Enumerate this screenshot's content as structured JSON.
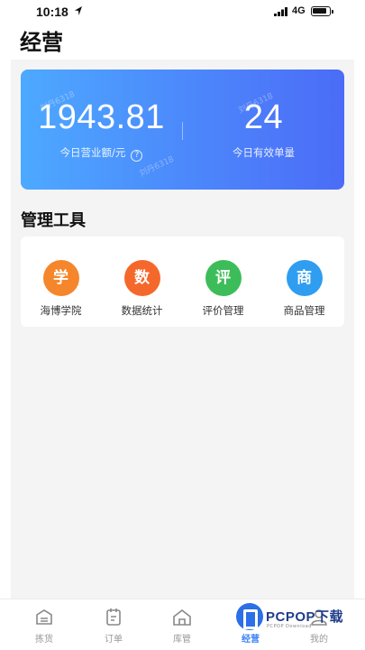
{
  "status_bar": {
    "time": "10:18",
    "network": "4G"
  },
  "page": {
    "title": "经营"
  },
  "summary": {
    "revenue_value": "1943.81",
    "revenue_label": "今日营业额/元",
    "help_symbol": "?",
    "orders_value": "24",
    "orders_label": "今日有效单量",
    "watermark": "刘丹6318"
  },
  "tools": {
    "title": "管理工具",
    "items": [
      {
        "glyph": "学",
        "label": "海博学院",
        "color": "#f5862b",
        "icon": "academy-icon"
      },
      {
        "glyph": "数",
        "label": "数据统计",
        "color": "#f5682b",
        "icon": "data-stats-icon"
      },
      {
        "glyph": "评",
        "label": "评价管理",
        "color": "#3dbd5a",
        "icon": "review-icon"
      },
      {
        "glyph": "商",
        "label": "商品管理",
        "color": "#2f9df0",
        "icon": "goods-icon"
      }
    ]
  },
  "tab_bar": {
    "items": [
      {
        "label": "拣货",
        "icon": "picking-icon",
        "active": false
      },
      {
        "label": "订单",
        "icon": "orders-icon",
        "active": false
      },
      {
        "label": "库管",
        "icon": "warehouse-icon",
        "active": false
      },
      {
        "label": "经营",
        "icon": "business-icon",
        "active": true
      },
      {
        "label": "我的",
        "icon": "profile-icon",
        "active": false
      }
    ],
    "active_color": "#3b82f6"
  },
  "watermark_logo": {
    "text": "PCPOP下载",
    "subtext": "PCPOP Download"
  }
}
